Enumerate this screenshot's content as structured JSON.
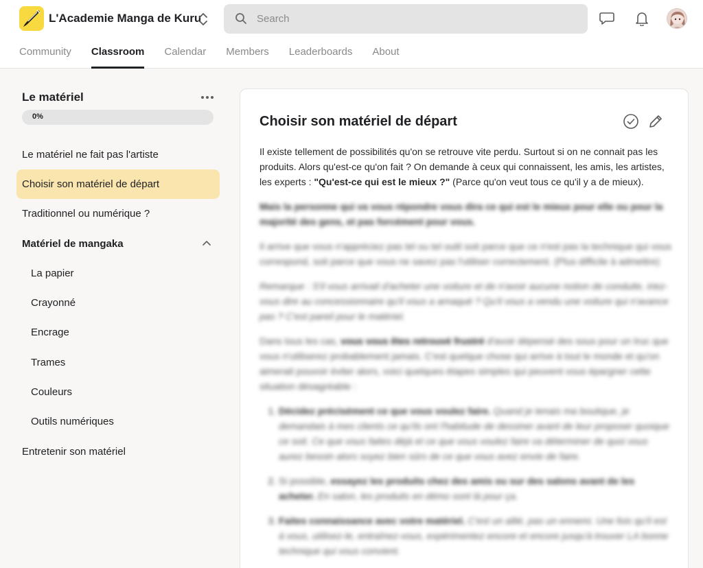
{
  "header": {
    "brand": "L'Academie Manga de Kuru",
    "search_placeholder": "Search"
  },
  "tabs": [
    {
      "label": "Community"
    },
    {
      "label": "Classroom"
    },
    {
      "label": "Calendar"
    },
    {
      "label": "Members"
    },
    {
      "label": "Leaderboards"
    },
    {
      "label": "About"
    }
  ],
  "active_tab": "Classroom",
  "sidebar": {
    "module_title": "Le matériel",
    "progress": {
      "value": 0,
      "label": "0%"
    },
    "items": [
      {
        "label": "Le matériel ne fait pas l'artiste"
      },
      {
        "label": "Choisir son matériel de départ"
      },
      {
        "label": "Traditionnel ou numérique ?"
      },
      {
        "label": "Matériel de mangaka"
      },
      {
        "label": "La papier"
      },
      {
        "label": "Crayonné"
      },
      {
        "label": "Encrage"
      },
      {
        "label": "Trames"
      },
      {
        "label": "Couleurs"
      },
      {
        "label": "Outils numériques"
      },
      {
        "label": "Entretenir son matériel"
      }
    ]
  },
  "lesson": {
    "title": "Choisir son matériel de départ",
    "intro_1": "Il existe tellement de possibilités qu'on se retrouve vite perdu. Surtout si on ne connait pas les produits. Alors qu'est-ce qu'on fait ? On demande à ceux qui connaissent, les amis, les artistes, les experts : ",
    "intro_bold": "\"Qu'est-ce qui est le mieux ?\"",
    "intro_2": " (Parce qu'on veut tous ce qu'il y a de mieux).",
    "p2_bold": "Mais la personne qui va vous répondre vous dira ce qui est le mieux pour elle ou pour la majorité des gens, et pas forcément pour vous.",
    "p3": "Il arrive que vous n'appréciez pas tel ou tel outil soit parce que ce n'est pas la technique qui vous correspond, soit parce que vous ne savez pas l'utiliser correctement. (Plus difficile à admettre)",
    "p4": "Remarque : S'il vous arrivait d'acheter une voiture et de n'avoir aucune notion de conduite, iriez-vous dire au concessionnaire qu'il vous a arnaqué ? Qu'il vous a vendu une voiture qui n'avance pas ? C'est pareil pour le matériel.",
    "p5_a": "Dans tous les cas, ",
    "p5_bold": "vous vous êtes retrouvé frustré",
    "p5_b": " d'avoir dépensé des sous pour un truc que vous n'utiliserez probablement jamais. C'est quelque chose qui arrive à tout le monde et qu'on aimerait pouvoir éviter alors, voici quelques étapes simples qui peuvent vous épargner cette situation désagréable :",
    "li1_bold": "Décidez précisément ce que vous voulez faire.",
    "li1_text": " Quand je tenais ma boutique, je demandais à mes clients ce qu'ils ont l'habitude de dessiner avant de leur proposer quoique ce soit. Ce que vous faites déjà et ce que vous voulez faire va déterminer de quoi vous aurez besoin alors soyez bien sûrs de ce que vous avez envie de faire.",
    "li2_a": "Si possible, ",
    "li2_bold": "essayez les produits chez des amis ou sur des salons avant de les acheter.",
    "li2_b": " En salon, les produits en démo sont là pour ça.",
    "li3_bold": "Faites connaissance avec votre matériel.",
    "li3_text": " C'est un allié, pas un ennemi. Une fois qu'il est à vous, utilisez-le, entraînez-vous, expérimentez encore et encore jusqu'à trouver LA bonne technique qui vous convient."
  },
  "colors": {
    "accent": "#f8d940",
    "active_nav_bg": "#fae5ae",
    "search_bg": "#e4e4e5",
    "page_bg": "#f8f7f5"
  },
  "icons": [
    "app-logo-icon",
    "switch-community-icon",
    "search-icon",
    "chat-icon",
    "bell-icon",
    "avatar",
    "more-icon",
    "chevron-up-icon",
    "check-circle-icon",
    "pencil-icon"
  ]
}
